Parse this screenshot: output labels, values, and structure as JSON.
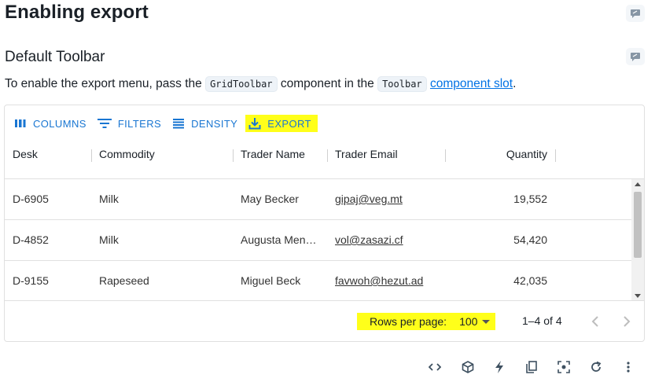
{
  "page": {
    "title": "Enabling export",
    "subtitle": "Default Toolbar",
    "intro": {
      "text1": "To enable the export menu, pass the ",
      "code1": "GridToolbar",
      "text2": " component in the ",
      "code2": "Toolbar",
      "text3": " ",
      "link": "component slot",
      "text4": "."
    }
  },
  "toolbar": {
    "columns": "COLUMNS",
    "filters": "FILTERS",
    "density": "DENSITY",
    "export": "EXPORT"
  },
  "columns": [
    "Desk",
    "Commodity",
    "Trader Name",
    "Trader Email",
    "Quantity"
  ],
  "rows": [
    {
      "desk": "D-6905",
      "commodity": "Milk",
      "trader_name": "May Becker",
      "trader_email": "gipaj@veg.mt",
      "quantity": "19,552"
    },
    {
      "desk": "D-4852",
      "commodity": "Milk",
      "trader_name": "Augusta Men…",
      "trader_email": "vol@zasazi.cf",
      "quantity": "54,420"
    },
    {
      "desk": "D-9155",
      "commodity": "Rapeseed",
      "trader_name": "Miguel Beck",
      "trader_email": "favwoh@hezut.ad",
      "quantity": "42,035"
    }
  ],
  "footer": {
    "rows_per_page_label": "Rows per page:",
    "rows_per_page_value": "100",
    "page_info": "1–4 of 4"
  },
  "colors": {
    "accent": "#1976d2",
    "highlight": "#ffff1a",
    "link": "#0072e5"
  },
  "bottom_toolbar_icons": [
    "code-icon",
    "codesandbox-icon",
    "stackblitz-icon",
    "copy-icon",
    "reset-focus-icon",
    "reset-icon",
    "more-icon"
  ]
}
